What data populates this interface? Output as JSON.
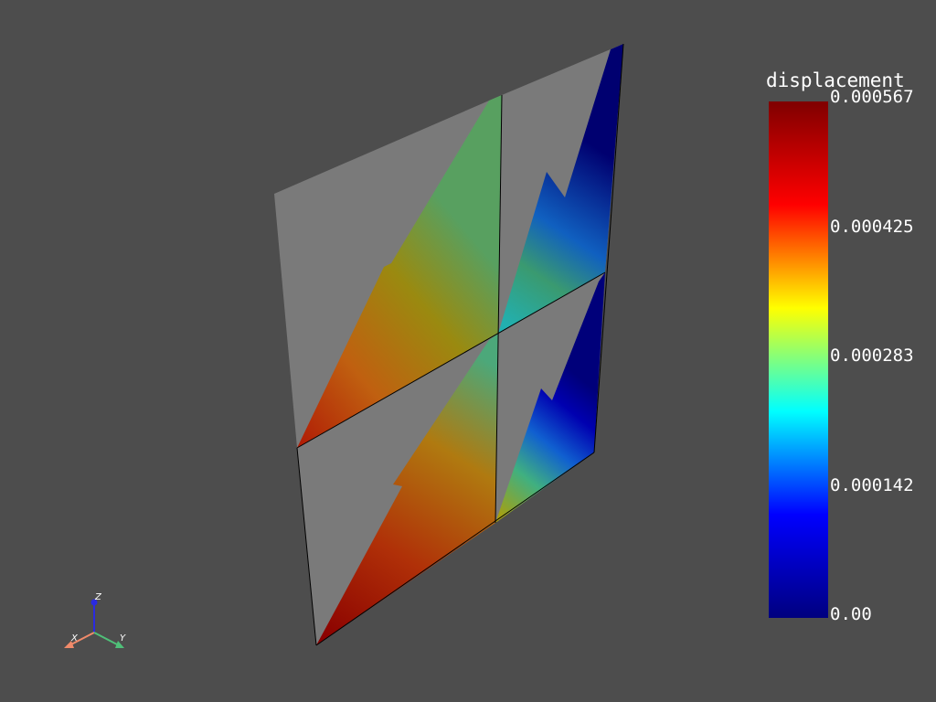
{
  "colorbar": {
    "title": "displacement",
    "tick_labels": [
      "0.000567",
      "0.000425",
      "0.000283",
      "0.000142",
      "0.00"
    ],
    "min": 0.0,
    "max": 0.000567,
    "colormap": "jet",
    "colors": [
      "#00007f",
      "#0000ff",
      "#00ffff",
      "#ffff00",
      "#ff0000",
      "#7f0000"
    ]
  },
  "axes_widget": {
    "x_label": "X",
    "y_label": "Y",
    "z_label": "Z",
    "x_color": "#f08a6a",
    "y_color": "#4fbf78",
    "z_color": "#2a2ae0"
  },
  "scene": {
    "background": "#4d4d4d",
    "surface_color": "#808080",
    "edge_color": "#000000"
  }
}
